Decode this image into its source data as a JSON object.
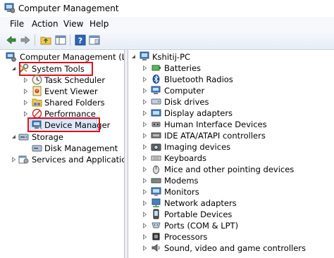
{
  "window": {
    "title": "Computer Management"
  },
  "menu": {
    "file": "File",
    "action": "Action",
    "view": "View",
    "help": "Help"
  },
  "toolbar": {
    "buttons": [
      "back-icon",
      "forward-icon",
      "up-folder-icon",
      "show-hide-tree-icon",
      "help-icon",
      "properties-icon"
    ]
  },
  "tree": {
    "root": "Computer Management (Local",
    "system_tools": "System Tools",
    "task_scheduler": "Task Scheduler",
    "event_viewer": "Event Viewer",
    "shared_folders": "Shared Folders",
    "performance": "Performance",
    "device_manager": "Device Manager",
    "storage": "Storage",
    "disk_management": "Disk Management",
    "services": "Services and Applications"
  },
  "devices": {
    "computer_name": "Kshitij-PC",
    "items": [
      "Batteries",
      "Bluetooth Radios",
      "Computer",
      "Disk drives",
      "Display adapters",
      "Human Interface Devices",
      "IDE ATA/ATAPI controllers",
      "Imaging devices",
      "Keyboards",
      "Mice and other pointing devices",
      "Modems",
      "Monitors",
      "Network adapters",
      "Portable Devices",
      "Ports (COM & LPT)",
      "Processors",
      "Sound, video and game controllers"
    ]
  },
  "colors": {
    "highlight_box": "#e0101c",
    "selection": "#dbe9f8"
  }
}
